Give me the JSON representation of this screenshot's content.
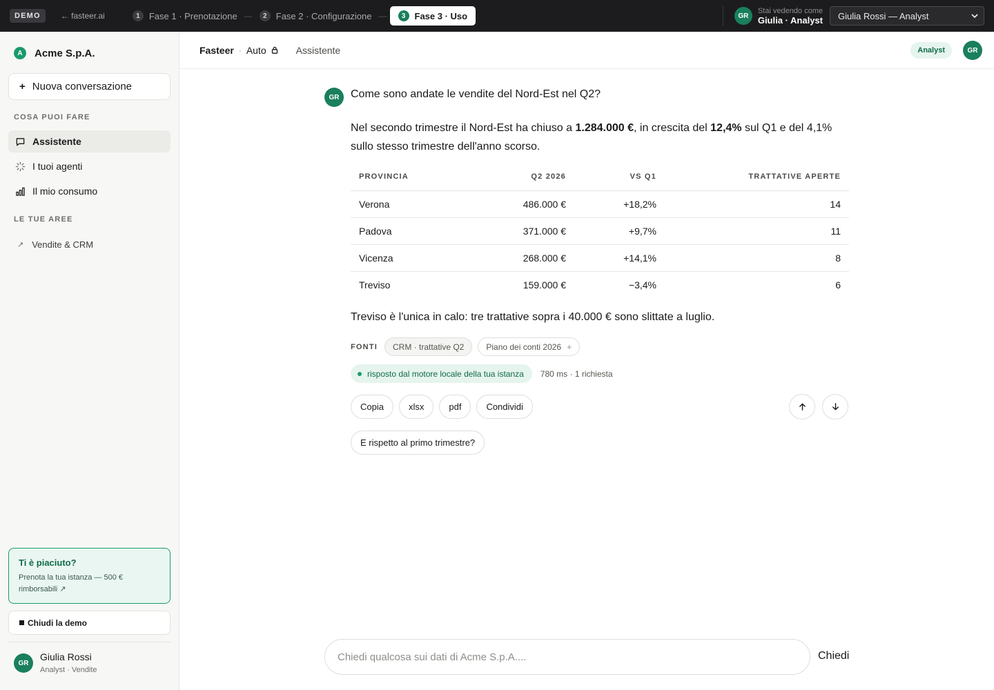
{
  "topbar": {
    "demo_badge": "DEMO",
    "back_link": "← fasteer.ai",
    "steps": [
      {
        "num": "1",
        "label": "Fase 1 · Prenotazione"
      },
      {
        "num": "2",
        "label": "Fase 2 · Configurazione"
      },
      {
        "num": "3",
        "label": "Fase 3 · Uso"
      }
    ],
    "step_separator": "—",
    "viewer_caption": "Stai vedendo come",
    "viewer_name": "Giulia · Analyst",
    "viewer_avatar": "GR",
    "viewer_select_value": "Giulia Rossi — Analyst"
  },
  "sidebar": {
    "org_initial": "A",
    "org_name": "Acme S.p.A.",
    "new_conversation": "Nuova conversazione",
    "section_actions": "COSA PUOI FARE",
    "nav_items": [
      {
        "label": "Assistente",
        "icon": "chat-icon"
      },
      {
        "label": "I tuoi agenti",
        "icon": "spinner-icon"
      },
      {
        "label": "Il mio consumo",
        "icon": "bar-chart-icon"
      }
    ],
    "section_areas": "LE TUE AREE",
    "areas": [
      {
        "label": "Vendite & CRM",
        "icon": "arrow-up-right-icon"
      }
    ],
    "promo_title": "Ti è piaciuto?",
    "promo_text": "Prenota la tua istanza — 500 € rimborsabili ↗",
    "close_demo": "Chiudi la demo",
    "user_avatar": "GR",
    "user_name": "Giulia Rossi",
    "user_role": "Analyst · Vendite"
  },
  "header": {
    "brand": "Fasteer",
    "separator": "·",
    "mode": "Auto",
    "tab": "Assistente",
    "role_pill": "Analyst",
    "avatar": "GR"
  },
  "conversation": {
    "user_avatar": "GR",
    "question": "Come sono andate le vendite del Nord-Est nel Q2?",
    "answer": {
      "p1": "Nel secondo trimestre il Nord-Est ha chiuso a ",
      "v1": "1.284.000 €",
      "p2": ", in crescita del ",
      "v2": "12,4%",
      "p3": " sul Q1 e del 4,1% sullo stesso trimestre dell'anno scorso."
    },
    "table": {
      "headers": [
        "PROVINCIA",
        "Q2 2026",
        "VS Q1",
        "TRATTATIVE APERTE"
      ],
      "rows": [
        [
          "Verona",
          "486.000 €",
          "+18,2%",
          "14"
        ],
        [
          "Padova",
          "371.000 €",
          "+9,7%",
          "11"
        ],
        [
          "Vicenza",
          "268.000 €",
          "+14,1%",
          "8"
        ],
        [
          "Treviso",
          "159.000 €",
          "−3,4%",
          "6"
        ]
      ]
    },
    "followup": "Treviso è l'unica in calo: tre trattative sopra i 40.000 € sono slittate a luglio.",
    "sources_label": "FONTI",
    "sources": [
      "CRM · trattative Q2",
      "Piano dei conti 2026"
    ],
    "source_plus": "+",
    "engine_badge": "risposto dal motore locale della tua istanza",
    "engine_meta": "780 ms · 1 richiesta",
    "actions": [
      "Copia",
      "xlsx",
      "pdf",
      "Condividi"
    ],
    "suggestion": "E rispetto al primo trimestre?"
  },
  "composer": {
    "placeholder": "Chiedi qualcosa sui dati di Acme S.p.A....",
    "send": "Chiedi"
  },
  "colors": {
    "accent": "#1a7f5c",
    "accent_light": "#e6f4ee",
    "topbar_bg": "#1c1c1e",
    "sidebar_bg": "#f7f7f6"
  }
}
